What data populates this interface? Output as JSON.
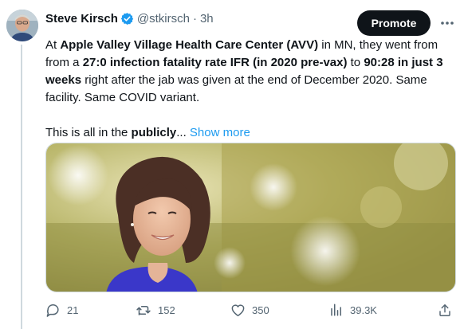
{
  "author": {
    "name": "Steve Kirsch",
    "handle": "@stkirsch",
    "separator": "·",
    "time": "3h",
    "verified_color": "#1d9bf0"
  },
  "promote_label": "Promote",
  "more_icon": "ellipsis-icon",
  "text": {
    "p1": [
      {
        "t": "At ",
        "b": false
      },
      {
        "t": "Apple Valley Village Health Care Center (AVV)",
        "b": true
      },
      {
        "t": " in MN, they went from from a ",
        "b": false
      },
      {
        "t": "27:0 infection fatality rate IFR (in 2020 pre-vax)",
        "b": true
      },
      {
        "t": " to ",
        "b": false
      },
      {
        "t": "90:28 in just 3 weeks",
        "b": true
      },
      {
        "t": " right after the jab was given at the end of December 2020. Same facility. Same COVID variant.",
        "b": false
      }
    ],
    "p2_prefix": "This is all in the ",
    "p2_bold": "publicly",
    "p2_ellipsis": "...",
    "show_more": "Show more"
  },
  "media": {
    "description_icon": "photo-woman-smiling"
  },
  "actions": {
    "replies": "21",
    "retweets": "152",
    "likes": "350",
    "views": "39.3K"
  },
  "colors": {
    "text": "#0f1419",
    "secondary": "#536471",
    "link": "#1d9bf0",
    "promote_bg": "#0f1419"
  }
}
